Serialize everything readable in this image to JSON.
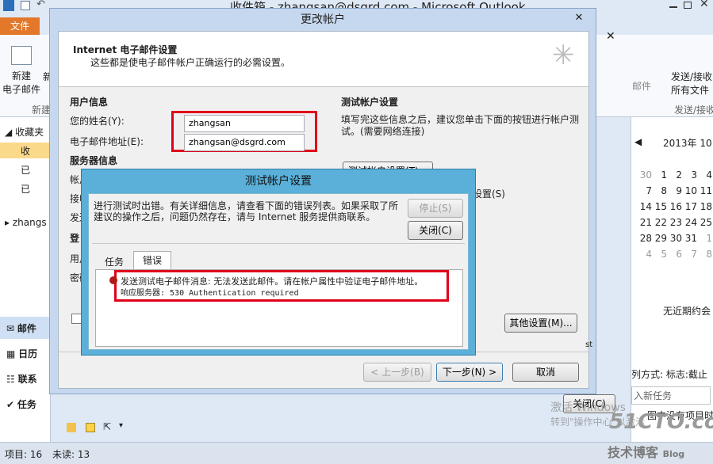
{
  "outlook": {
    "window_title": "收件箱 - zhangsan@dsgrd.com - Microsoft Outlook",
    "file_tab": "文件",
    "ribbon": {
      "new_email_line1": "新建",
      "new_email_line2": "电子邮件",
      "new_group": "新建",
      "new_partial": "新",
      "send_receive_line1": "发送/接收",
      "send_receive_line2": "所有文件",
      "send_receive_group": "发送/接收",
      "mail_partial": "邮件"
    },
    "nav": {
      "favorites": "收藏夹",
      "inbox_partial": "收",
      "sent_partial": "已",
      "deleted_partial": "已",
      "account_partial": "zhangs",
      "mail": "邮件",
      "calendar": "日历",
      "contacts": "联系",
      "tasks": "任务"
    },
    "calendar": {
      "month_title": "2013年 10",
      "rows": [
        [
          "30",
          "1",
          "2",
          "3",
          "4"
        ],
        [
          "7",
          "8",
          "9",
          "10",
          "11"
        ],
        [
          "14",
          "15",
          "16",
          "17",
          "18"
        ],
        [
          "21",
          "22",
          "23",
          "24",
          "25"
        ],
        [
          "28",
          "29",
          "30",
          "31",
          "1"
        ],
        [
          "4",
          "5",
          "6",
          "7",
          "8"
        ]
      ]
    },
    "right_pane": {
      "no_appointments": "无近期约会",
      "arrange_by": "列方式: 标志:截止",
      "new_task": "入新任务",
      "no_items": "图中没有项目时"
    },
    "status": {
      "items": "项目: 16",
      "unread": "未读: 13"
    },
    "watermark": {
      "activate_line1": "激活 Windows",
      "activate_line2": "转到\"操作中心\"以激活",
      "site": "51CTO.com",
      "blog": "技术博客",
      "blog_en": "Blog"
    }
  },
  "change_account": {
    "title": "更改帐户",
    "header_title": "Internet 电子邮件设置",
    "header_subtitle": "这些都是使电子邮件帐户正确运行的必需设置。",
    "user_info_heading": "用户信息",
    "name_label": "您的姓名(Y):",
    "name_value": "zhangsan",
    "email_label": "电子邮件地址(E):",
    "email_value": "zhangsan@dsgrd.com",
    "server_info_heading": "服务器信息",
    "account_type_partial": "帐户",
    "incoming_partial": "接收",
    "outgoing_partial": "发送",
    "logon_heading_partial": "登",
    "user_partial": "用户",
    "password_partial": "密码",
    "test_heading": "测试帐户设置",
    "test_desc": "填写完这些信息之后，建议您单击下面的按钮进行帐户测试。(需要网络连接)",
    "test_button": "测试帐户设置(T)...",
    "test_checkbox_tail": "设置(S)",
    "more_settings": "其他设置(M)...",
    "back_button": "< 上一步(B)",
    "next_button": "下一步(N) >",
    "cancel_button": "取消",
    "partial_st": "st",
    "close_bg_button": "关闭(C)"
  },
  "test_dialog": {
    "title": "测试帐户设置",
    "message": "进行测试时出错。有关详细信息，请查看下面的错误列表。如果采取了所建议的操作之后，问题仍然存在，请与 Internet 服务提供商联系。",
    "stop_button": "停止(S)",
    "close_button": "关闭(C)",
    "tabs": [
      "任务",
      "错误"
    ],
    "error_line1": "发送测试电子邮件消息: 无法发送此邮件。请在帐户属性中验证电子邮件地址。",
    "error_line2": "响应服务器: 530 Authentication required"
  }
}
